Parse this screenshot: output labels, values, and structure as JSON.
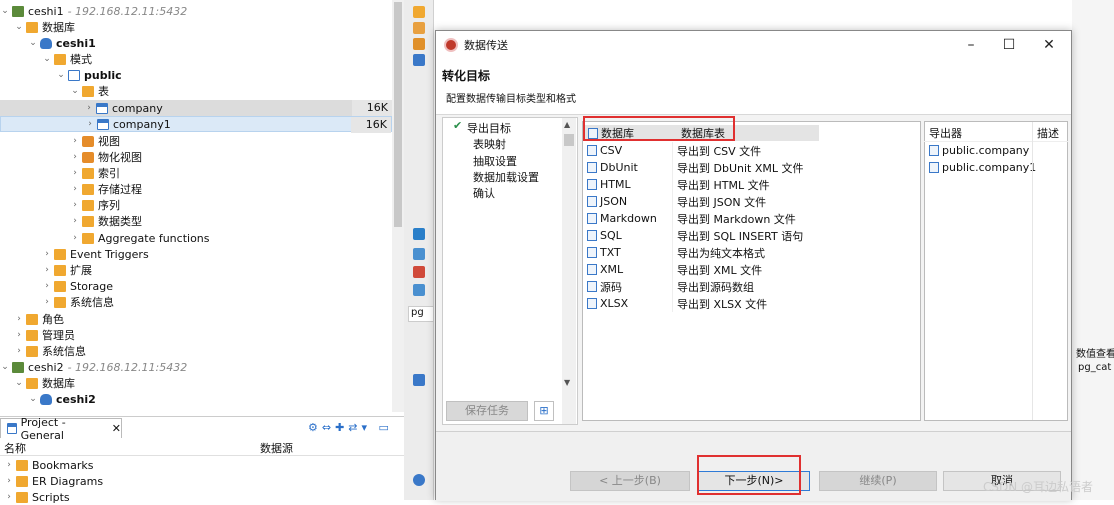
{
  "tree": {
    "conn1": {
      "name": "ceshi1",
      "host": "- 192.168.12.11:5432"
    },
    "databases_label": "数据库",
    "db1": "ceshi1",
    "schemas_label": "模式",
    "schema": "public",
    "tables_label": "表",
    "table1": {
      "name": "company",
      "size": "16K"
    },
    "table2": {
      "name": "company1",
      "size": "16K"
    },
    "views": "视图",
    "mviews": "物化视图",
    "indexes": "索引",
    "procs": "存储过程",
    "sequences": "序列",
    "datatypes": "数据类型",
    "aggfuncs": "Aggregate functions",
    "event_triggers": "Event Triggers",
    "extensions": "扩展",
    "storage": "Storage",
    "sysinfo1": "系统信息",
    "roles": "角色",
    "admins": "管理员",
    "sysinfo2": "系统信息",
    "conn2": {
      "name": "ceshi2",
      "host": "- 192.168.12.11:5432"
    },
    "databases2_label": "数据库",
    "db2": "ceshi2"
  },
  "project": {
    "tab_label": "Project - General",
    "col_name": "名称",
    "col_source": "数据源",
    "items": [
      "Bookmarks",
      "ER Diagrams",
      "Scripts"
    ]
  },
  "dialog": {
    "title": "数据传送",
    "heading": "转化目标",
    "subtitle": "配置数据传输目标类型和格式",
    "steps": [
      "导出目标",
      "表映射",
      "抽取设置",
      "数据加载设置",
      "确认"
    ],
    "save_task": "保存任务",
    "format_headers": {
      "db": "数据库",
      "dbtable": "数据库表"
    },
    "formats": [
      {
        "name": "CSV",
        "desc": "导出到 CSV 文件"
      },
      {
        "name": "DbUnit",
        "desc": "导出到 DbUnit XML 文件"
      },
      {
        "name": "HTML",
        "desc": "导出到 HTML 文件"
      },
      {
        "name": "JSON",
        "desc": "导出到 JSON 文件"
      },
      {
        "name": "Markdown",
        "desc": "导出到 Markdown 文件"
      },
      {
        "name": "SQL",
        "desc": "导出到 SQL INSERT 语句"
      },
      {
        "name": "TXT",
        "desc": "导出为纯文本格式"
      },
      {
        "name": "XML",
        "desc": "导出到 XML 文件"
      },
      {
        "name": "源码",
        "desc": "导出到源码数组"
      },
      {
        "name": "XLSX",
        "desc": "导出到 XLSX 文件"
      }
    ],
    "export_headers": {
      "exporter": "导出器",
      "desc": "描述"
    },
    "exports": [
      "public.company",
      "public.company1"
    ],
    "buttons": {
      "prev": "< 上一步(B)",
      "next": "下一步(N)>",
      "continue": "继续(P)",
      "cancel": "取消"
    }
  },
  "side": {
    "tab_label": "pg",
    "right_label": "数值查看",
    "right_value": "pg_cat"
  },
  "watermark": "CSDN @耳边私语者"
}
